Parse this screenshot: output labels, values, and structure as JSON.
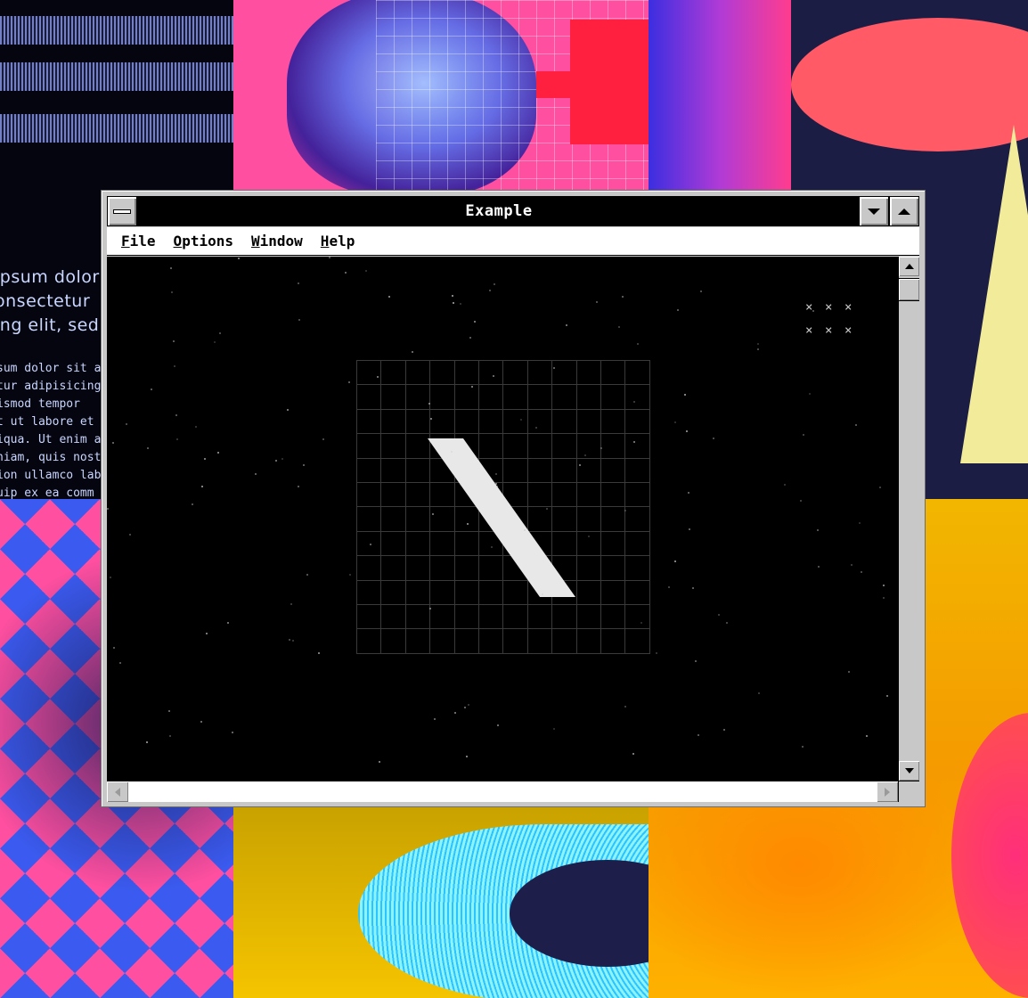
{
  "background": {
    "headline_lines": [
      "ipsum dolor",
      "onsectetur",
      "ing elit, sed."
    ],
    "body_lines": [
      "sum dolor sit an",
      "tur adipisicing e",
      "ismod tempor",
      "t ut labore et de",
      "iqua. Ut enim ad",
      "niam, quis nostr",
      "ion ullamco labo",
      "uip ex ea comm"
    ]
  },
  "window": {
    "title": "Example",
    "system_menu_icon": "system-menu-bar",
    "title_buttons": [
      "minimize-icon",
      "maximize-icon"
    ]
  },
  "menubar": {
    "items": [
      "File",
      "Options",
      "Window",
      "Help"
    ]
  },
  "content": {
    "decoration": "x-marks",
    "x_marks": [
      "×",
      "×",
      "×",
      "×",
      "×",
      "×"
    ]
  },
  "colors": {
    "window_chrome": "#c8c8c8",
    "titlebar": "#000000",
    "content_bg": "#000000",
    "grid_line": "#3a3a3a",
    "slash": "#e8e8e8"
  }
}
